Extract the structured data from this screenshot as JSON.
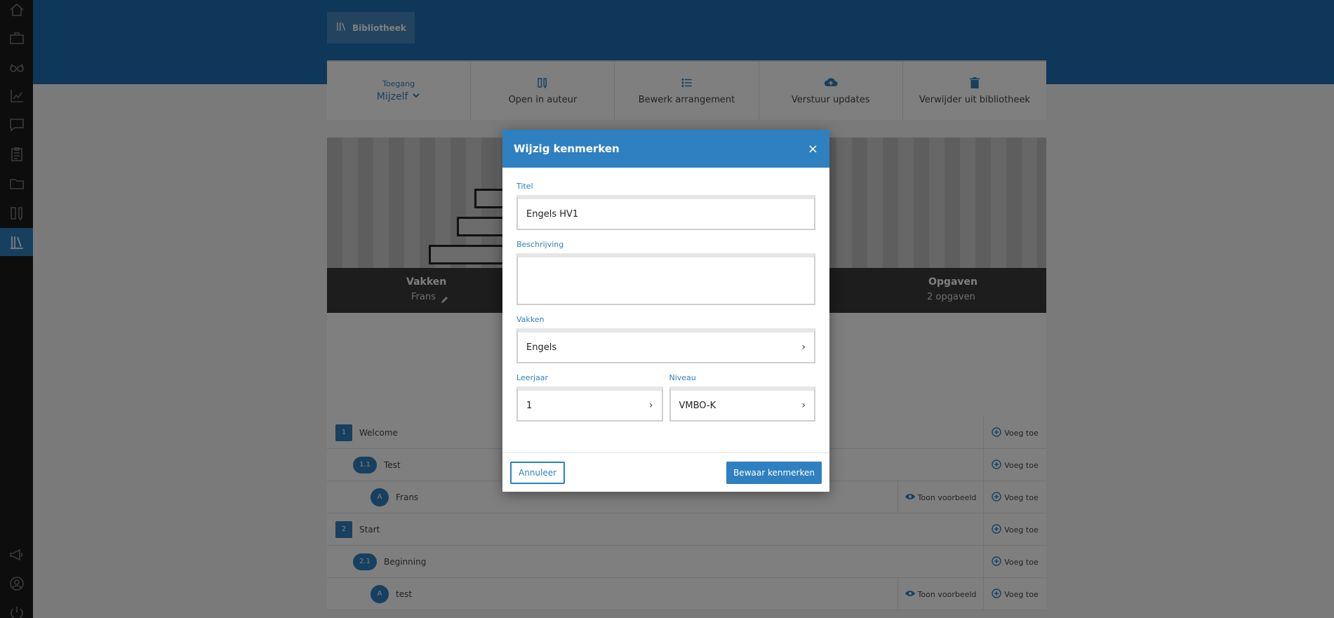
{
  "breadcrumb": {
    "label": "Bibliotheek"
  },
  "toolbar": {
    "access_label": "Toegang",
    "access_value": "Mijzelf",
    "open_author": "Open in auteur",
    "edit_arrangement": "Bewerk arrangement",
    "send_updates": "Verstuur updates",
    "remove_library": "Verwijder uit bibliotheek"
  },
  "cover": {
    "subjects_label": "Vakken",
    "subjects_value": "Frans",
    "tasks_label": "Opgaven",
    "tasks_value": "2 opgaven"
  },
  "rows": [
    {
      "badge": "1",
      "label": "Welcome",
      "add": "Voeg toe"
    },
    {
      "badge": "1.1",
      "label": "Test",
      "add": "Voeg toe"
    },
    {
      "badge": "A",
      "label": "Frans",
      "preview": "Toon voorbeeld",
      "add": "Voeg toe"
    },
    {
      "badge": "2",
      "label": "Start",
      "add": "Voeg toe"
    },
    {
      "badge": "2.1",
      "label": "Beginning",
      "add": "Voeg toe"
    },
    {
      "badge": "A",
      "label": "test",
      "preview": "Toon voorbeeld",
      "add": "Voeg toe"
    }
  ],
  "modal": {
    "title": "Wijzig kenmerken",
    "close": "×",
    "title_label": "Titel",
    "title_value": "Engels HV1",
    "description_label": "Beschrijving",
    "description_value": "",
    "subjects_label": "Vakken",
    "subjects_value": "Engels",
    "year_label": "Leerjaar",
    "year_value": "1",
    "level_label": "Niveau",
    "level_value": "VMBO-K",
    "cancel": "Annuleer",
    "save": "Bewaar kenmerken"
  },
  "colors": {
    "primary": "#2f80c0",
    "header": "#1f6fb4",
    "sidebar": "#1a1a1a"
  }
}
